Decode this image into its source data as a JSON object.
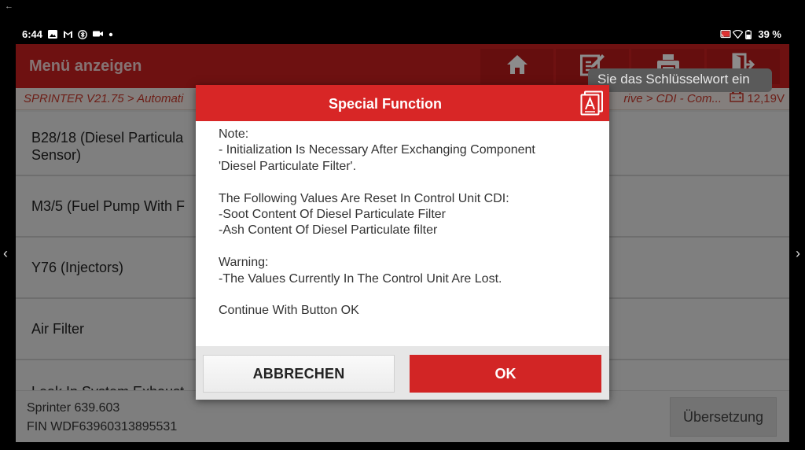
{
  "system": {
    "back_glyph": "←",
    "time": "6:44",
    "battery": "39 %",
    "status_icons_left": [
      "image-icon",
      "gmail-icon",
      "bluetooth-icon",
      "camera-icon",
      "dot-icon"
    ],
    "status_icons_right": [
      "cast-icon",
      "wifi-icon",
      "battery-icon"
    ]
  },
  "header": {
    "title": "Menü anzeigen",
    "buttons": [
      "home-icon",
      "report-edit-icon",
      "print-icon",
      "exit-icon"
    ]
  },
  "breadcrumb": {
    "left": "SPRINTER V21.75 > Automati",
    "right": "rive > CDI -  Com...",
    "voltage": "12,19V"
  },
  "search": {
    "placeholder": "Sie das Schlüsselwort ein"
  },
  "list": {
    "items": [
      "B28/18 (Diesel Particula",
      "Sensor)",
      "M3/5 (Fuel Pump With F",
      "Y76 (Injectors)",
      "Air Filter",
      "Leak In System Exhaust"
    ]
  },
  "vehicle": {
    "model": "Sprinter 639.603",
    "vin": "FIN WDF63960313895531"
  },
  "translate_button": "Übersetzung",
  "nav": {
    "prev": "‹",
    "next": "›"
  },
  "dialog": {
    "title": "Special Function",
    "lines": [
      "Note:",
      "- Initialization Is Necessary After Exchanging Component",
      "'Diesel Particulate Filter'.",
      "",
      "The Following Values Are Reset In Control Unit CDI:",
      "-Soot Content Of Diesel Particulate Filter",
      "-Ash Content Of Diesel Particulate filter",
      "",
      "Warning:",
      "-The Values Currently In The Control Unit Are Lost.",
      "",
      "Continue With Button OK"
    ],
    "cancel_label": "ABBRECHEN",
    "ok_label": "OK"
  },
  "colors": {
    "header_red": "#c81f1f",
    "dialog_red": "#d82626",
    "breadcrumb_text": "#c7392c"
  }
}
